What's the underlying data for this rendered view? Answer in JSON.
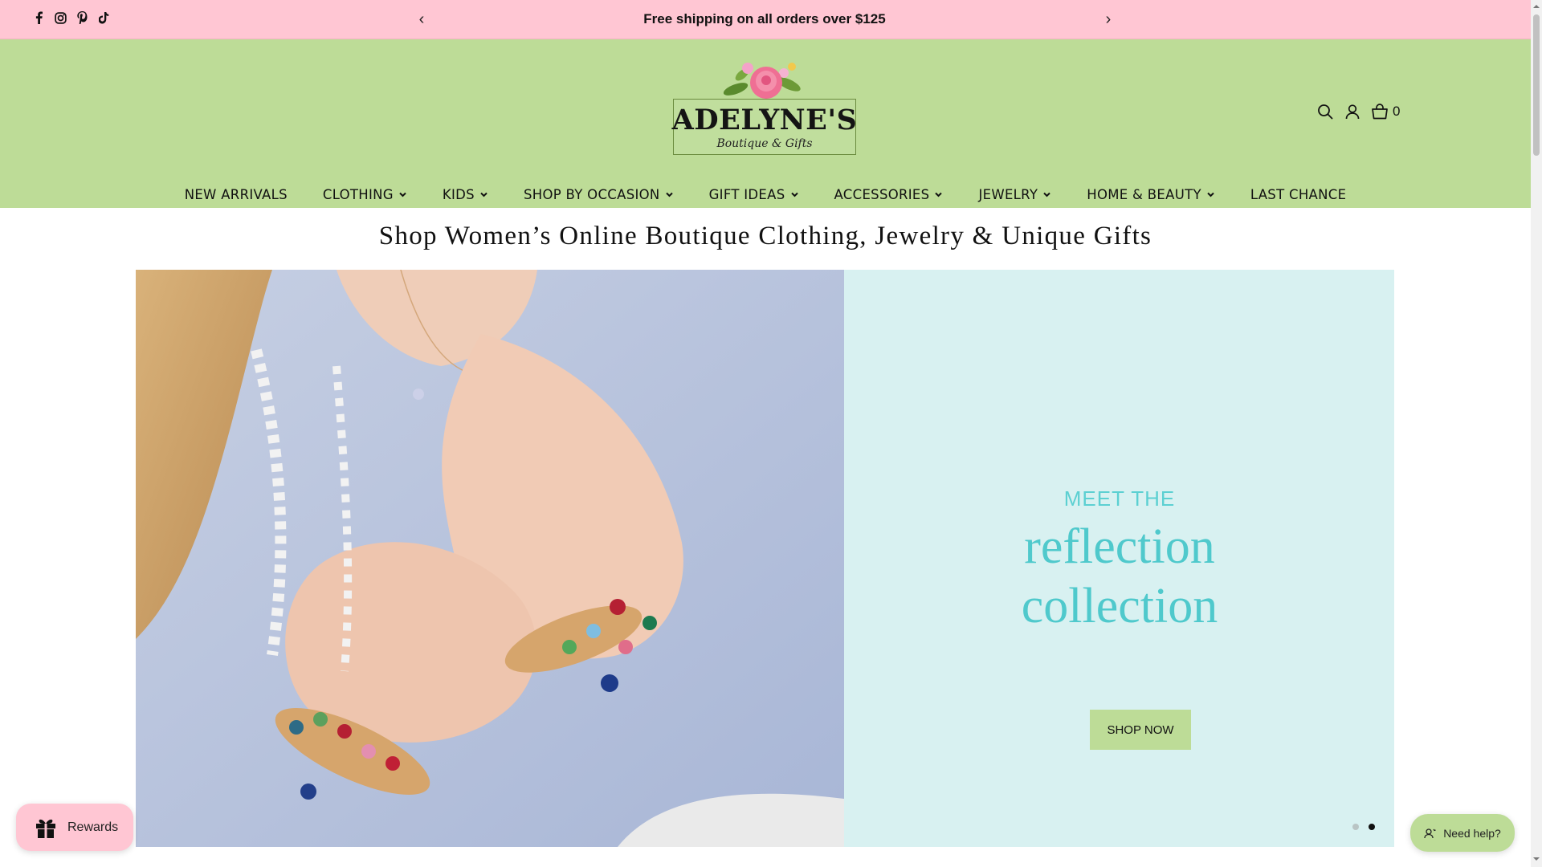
{
  "announcement": {
    "text": "Free shipping on all orders over $125",
    "prev": "‹",
    "next": "›"
  },
  "social_icons": [
    "facebook-icon",
    "instagram-icon",
    "pinterest-icon",
    "tiktok-icon"
  ],
  "logo": {
    "name": "ADELYNE'S",
    "subtitle": "Boutique & Gifts"
  },
  "header": {
    "cart_count": "0"
  },
  "nav": [
    {
      "label": "NEW ARRIVALS",
      "dropdown": false
    },
    {
      "label": "CLOTHING",
      "dropdown": true
    },
    {
      "label": "KIDS",
      "dropdown": true
    },
    {
      "label": "SHOP BY OCCASION",
      "dropdown": true
    },
    {
      "label": "GIFT IDEAS",
      "dropdown": true
    },
    {
      "label": "ACCESSORIES",
      "dropdown": true
    },
    {
      "label": "JEWELRY",
      "dropdown": true
    },
    {
      "label": "HOME & BEAUTY",
      "dropdown": true
    },
    {
      "label": "LAST CHANCE",
      "dropdown": false
    }
  ],
  "headline": "Shop Women’s Online Boutique Clothing, Jewelry & Unique Gifts",
  "hero": {
    "eyebrow": "MEET THE",
    "title_line1": "reflection",
    "title_line2": "collection",
    "cta": "SHOP NOW",
    "slides": 2,
    "active_slide": 2
  },
  "rewards": {
    "label": "Rewards"
  },
  "help": {
    "label": "Need help?"
  },
  "colors": {
    "announcement_bg": "#ffc6d3",
    "header_bg": "#bddc97",
    "hero_panel_bg": "#d8f1f1",
    "hero_accent": "#4fc9cc"
  }
}
